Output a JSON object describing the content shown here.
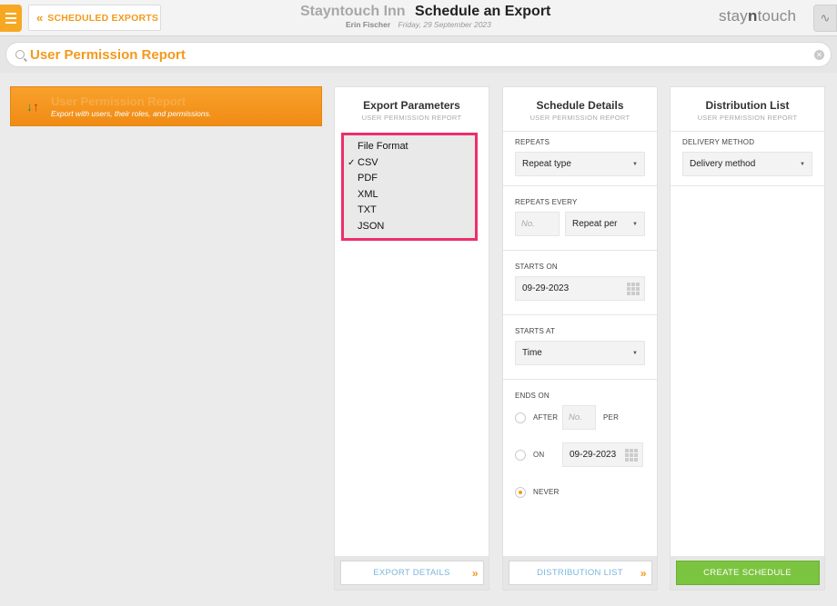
{
  "header": {
    "back_label": "SCHEDULED EXPORTS",
    "hotel_name": "Stayntouch Inn",
    "page_title": "Schedule an Export",
    "user_name": "Erin Fischer",
    "date": "Friday, 29 September 2023",
    "brand_prefix": "stay",
    "brand_mid": "n",
    "brand_suffix": "touch"
  },
  "search": {
    "value": "User Permission Report"
  },
  "report": {
    "title": "User Permission Report",
    "description": "Export with users, their roles, and permissions."
  },
  "export_params": {
    "title": "Export Parameters",
    "subtitle": "USER PERMISSION REPORT",
    "file_format_dropdown": {
      "header": "File Format",
      "options": [
        "CSV",
        "PDF",
        "XML",
        "TXT",
        "JSON"
      ],
      "selected": "CSV"
    },
    "footer_button": "EXPORT DETAILS"
  },
  "schedule": {
    "title": "Schedule Details",
    "subtitle": "USER PERMISSION REPORT",
    "repeats_label": "REPEATS",
    "repeats_value": "Repeat type",
    "repeats_every_label": "REPEATS EVERY",
    "repeats_every_placeholder": "No.",
    "repeat_per_value": "Repeat per",
    "starts_on_label": "STARTS ON",
    "starts_on_value": "09-29-2023",
    "starts_at_label": "STARTS AT",
    "starts_at_value": "Time",
    "ends_on_label": "ENDS ON",
    "ends_after_label": "AFTER",
    "ends_after_placeholder": "No.",
    "ends_after_suffix": "PER",
    "ends_on_option_label": "ON",
    "ends_on_date": "09-29-2023",
    "ends_never_label": "NEVER",
    "footer_button": "DISTRIBUTION LIST"
  },
  "distribution": {
    "title": "Distribution List",
    "subtitle": "USER PERMISSION REPORT",
    "delivery_label": "DELIVERY METHOD",
    "delivery_value": "Delivery method",
    "create_button": "CREATE SCHEDULE"
  }
}
